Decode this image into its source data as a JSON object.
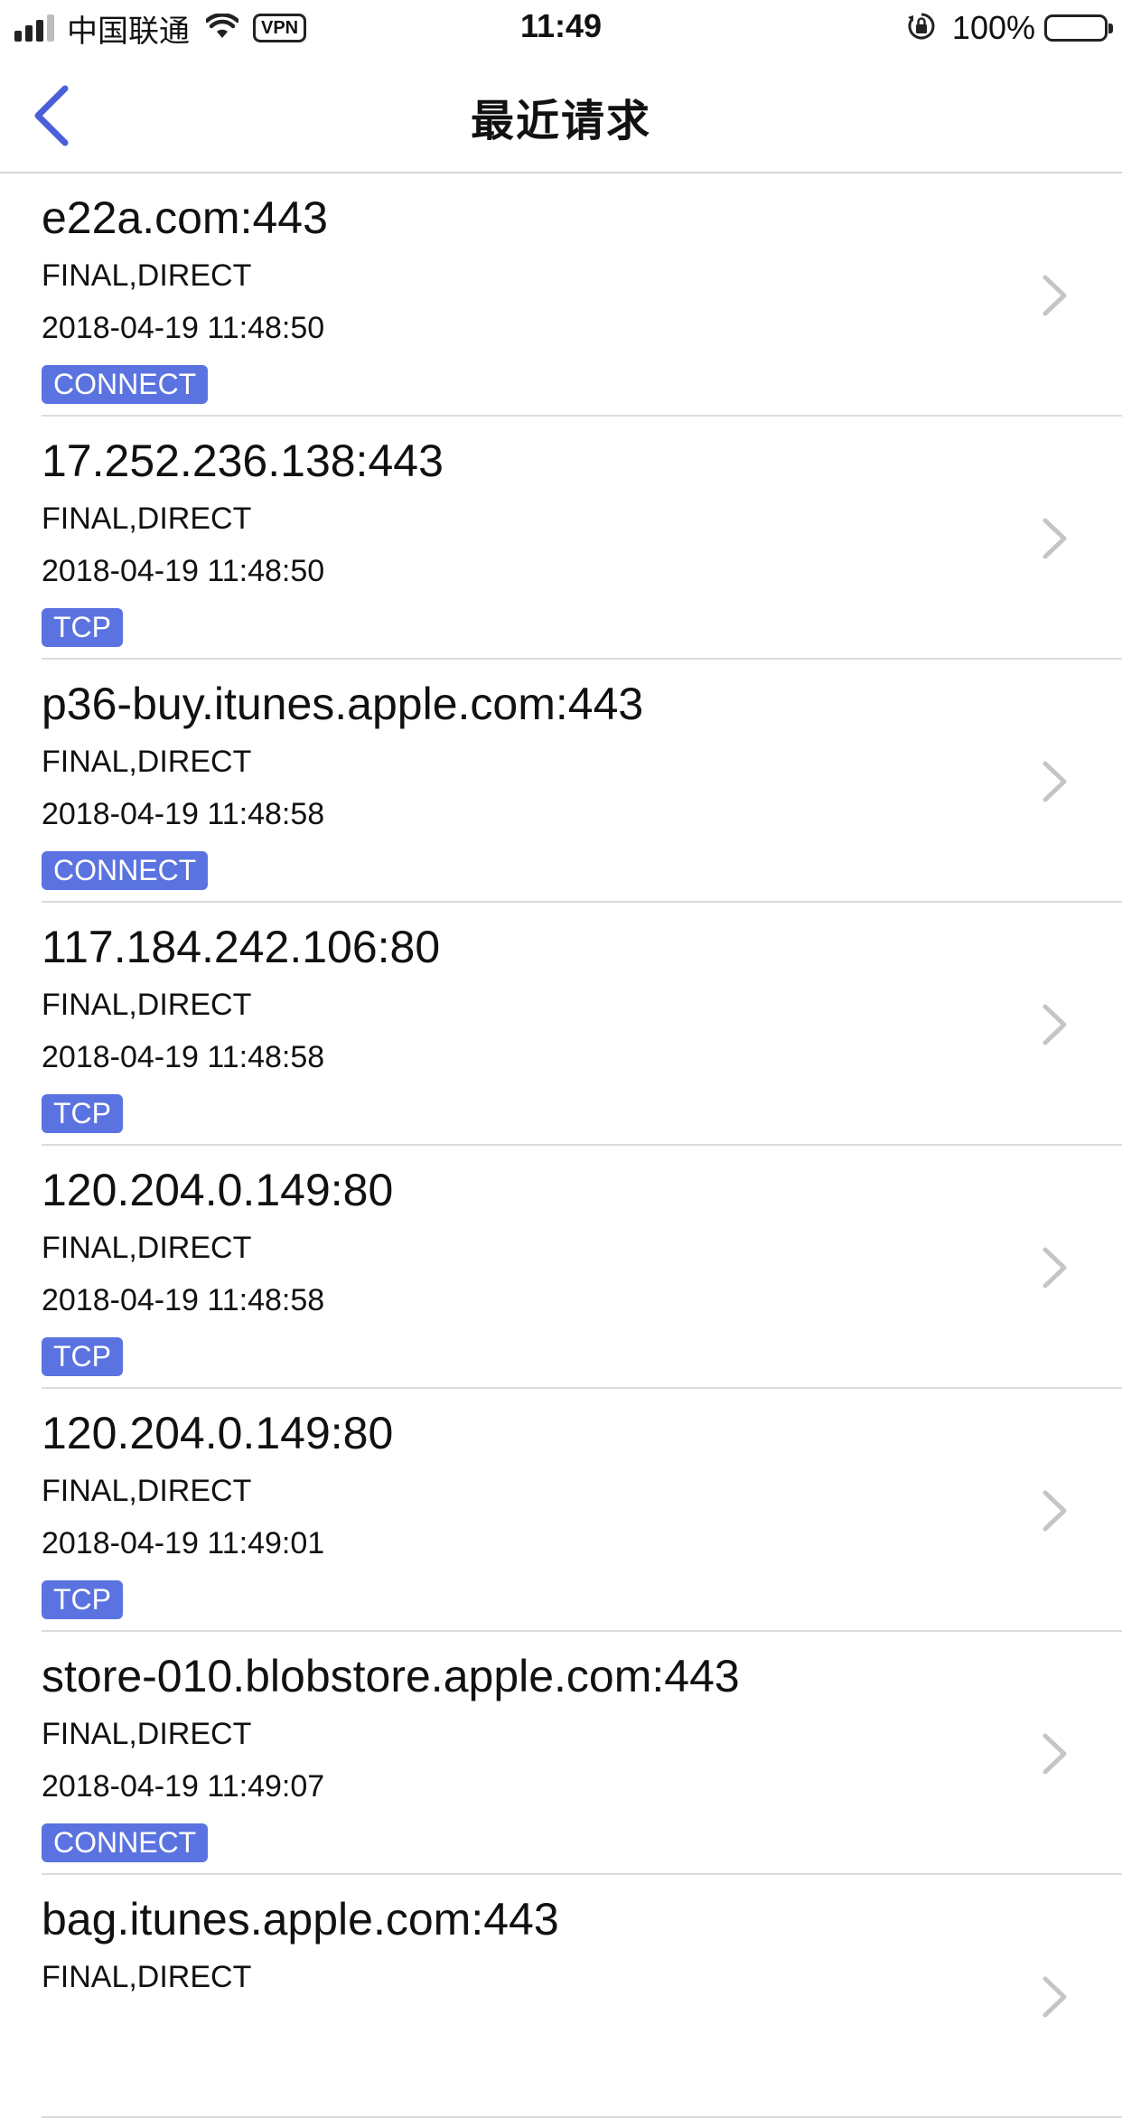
{
  "status_bar": {
    "carrier": "中国联通",
    "vpn": "VPN",
    "time": "11:49",
    "battery_percent": "100%",
    "signal_strength": 3,
    "signal_max": 4
  },
  "nav": {
    "title": "最近请求",
    "back_icon": "chevron-left-icon",
    "accent_color": "#4a5fd8"
  },
  "tag_color": "#5b73e0",
  "requests": [
    {
      "host": "e22a.com:443",
      "rule": "FINAL,DIRECT",
      "time": "2018-04-19 11:48:50",
      "type": "CONNECT"
    },
    {
      "host": "17.252.236.138:443",
      "rule": "FINAL,DIRECT",
      "time": "2018-04-19 11:48:50",
      "type": "TCP"
    },
    {
      "host": "p36-buy.itunes.apple.com:443",
      "rule": "FINAL,DIRECT",
      "time": "2018-04-19 11:48:58",
      "type": "CONNECT"
    },
    {
      "host": "117.184.242.106:80",
      "rule": "FINAL,DIRECT",
      "time": "2018-04-19 11:48:58",
      "type": "TCP"
    },
    {
      "host": "120.204.0.149:80",
      "rule": "FINAL,DIRECT",
      "time": "2018-04-19 11:48:58",
      "type": "TCP"
    },
    {
      "host": "120.204.0.149:80",
      "rule": "FINAL,DIRECT",
      "time": "2018-04-19 11:49:01",
      "type": "TCP"
    },
    {
      "host": "store-010.blobstore.apple.com:443",
      "rule": "FINAL,DIRECT",
      "time": "2018-04-19 11:49:07",
      "type": "CONNECT"
    },
    {
      "host": "bag.itunes.apple.com:443",
      "rule": "FINAL,DIRECT",
      "time": "",
      "type": ""
    }
  ]
}
